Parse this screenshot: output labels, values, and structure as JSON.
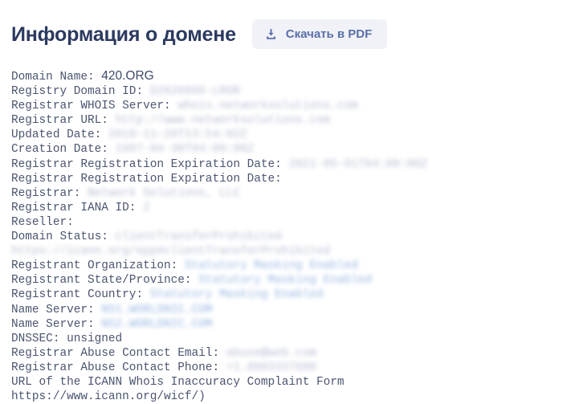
{
  "header": {
    "title": "Информация о домене",
    "download_button": {
      "label": "Скачать в PDF",
      "icon": "download-icon"
    }
  },
  "theme": {
    "title_color": "#2c3a60",
    "button_bg": "#f0f2f7",
    "button_text": "#5b6fa8",
    "body_text": "#4b5570",
    "masked_text": "#8c97b8",
    "masked_link": "#6f9ad6",
    "page_bg": "#ffffff"
  },
  "whois": {
    "lines": [
      {
        "label": "Domain Name: ",
        "value": "420.ORG",
        "style": "domain"
      },
      {
        "label": "Registry Domain ID: ",
        "value": "D2026066-LROR",
        "style": "masked"
      },
      {
        "label": "Registrar WHOIS Server: ",
        "value": "whois.networksolutions.com",
        "style": "masked"
      },
      {
        "label": "Registrar URL: ",
        "value": "http://www.networksolutions.com",
        "style": "masked"
      },
      {
        "label": "Updated Date: ",
        "value": "2018-11-20T13:54:02Z",
        "style": "masked"
      },
      {
        "label": "Creation Date: ",
        "value": "1997-04-30T04:00:00Z",
        "style": "masked"
      },
      {
        "label": "Registrar Registration Expiration Date: ",
        "value": "2021-05-01T04:00:00Z",
        "style": "masked"
      },
      {
        "label": "Registrar Registration Expiration Date: ",
        "value": "",
        "style": "plain"
      },
      {
        "label": "Registrar: ",
        "value": "Network Solutions, LLC",
        "style": "masked"
      },
      {
        "label": "Registrar IANA ID: ",
        "value": "2",
        "style": "masked"
      },
      {
        "label": "Reseller: ",
        "value": "",
        "style": "plain"
      },
      {
        "label": "Domain Status: ",
        "value": "clientTransferProhibited https://icann.org/epp#clientTransferProhibited",
        "style": "masked"
      },
      {
        "label": "Registrant Organization: ",
        "value": "Statutory Masking Enabled",
        "style": "masked-blue"
      },
      {
        "label": "Registrant State/Province: ",
        "value": "Statutory Masking Enabled",
        "style": "masked-blue"
      },
      {
        "label": "Registrant Country: ",
        "value": "Statutory Masking Enabled",
        "style": "masked-blue"
      },
      {
        "label": "Name Server: ",
        "value": "NS1.WORLDNIC.COM",
        "style": "masked-blue"
      },
      {
        "label": "Name Server: ",
        "value": "NS2.WORLDNIC.COM",
        "style": "masked-blue"
      },
      {
        "label": "DNSSEC: ",
        "value": "unsigned",
        "style": "plain"
      },
      {
        "label": "Registrar Abuse Contact Email: ",
        "value": "abuse@web.com",
        "style": "masked"
      },
      {
        "label": "Registrar Abuse Contact Phone: ",
        "value": "+1.8003337680",
        "style": "masked"
      },
      {
        "label": "URL of the ICANN Whois Inaccuracy Complaint Form https://www.icann.org/wicf/)",
        "value": "",
        "style": "plain"
      }
    ]
  }
}
